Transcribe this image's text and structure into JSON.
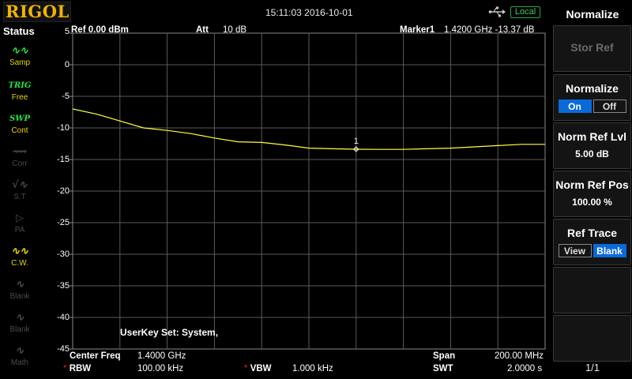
{
  "brand": "RIGOL",
  "datetime": "15:11:03 2016-10-01",
  "local_label": "Local",
  "status": {
    "title": "Status",
    "items": [
      {
        "icon": "samp-wave-icon",
        "glyph": "∿∿",
        "label": "Samp"
      },
      {
        "icon": "trig-icon",
        "glyph": "TRIG",
        "label": "Free"
      },
      {
        "icon": "swp-icon",
        "glyph": "SWP",
        "label": "Cont"
      },
      {
        "icon": "corr-icon",
        "glyph": "⟿",
        "label": "Corr"
      },
      {
        "icon": "st-icon",
        "glyph": "√∿",
        "label": "S.T"
      },
      {
        "icon": "pa-icon",
        "glyph": "▷",
        "label": "PA"
      },
      {
        "icon": "cw-icon",
        "glyph": "∿∿",
        "label": "C.W."
      },
      {
        "icon": "blank-icon",
        "glyph": "∿",
        "label": "Blank"
      },
      {
        "icon": "blank-icon",
        "glyph": "∿",
        "label": "Blank"
      },
      {
        "icon": "math-icon",
        "glyph": "∿",
        "label": "Math"
      }
    ]
  },
  "plot": {
    "ref": "Ref  0.00 dBm",
    "att_label": "Att",
    "att_value": "10 dB",
    "marker_label": "Marker1",
    "marker_value": "1.4200 GHz  -13.37 dB",
    "marker_number": "1",
    "y_labels": [
      "5",
      "0",
      "-5",
      "-10",
      "-15",
      "-20",
      "-25",
      "-30",
      "-35",
      "-40",
      "-45"
    ],
    "userkey": "UserKey Set:    System,",
    "center_freq_label": "Center Freq",
    "center_freq_value": "1.4000 GHz",
    "span_label": "Span",
    "span_value": "200.00 MHz",
    "rbw_label": "RBW",
    "rbw_value": "100.00 kHz",
    "vbw_label": "VBW",
    "vbw_value": "1.000 kHz",
    "swt_label": "SWT",
    "swt_value": "2.0000 s",
    "trace_color": "#ffff40",
    "grid_color": "#5a5a5a"
  },
  "chart_data": {
    "type": "line",
    "x": [
      1.3,
      1.31,
      1.32,
      1.33,
      1.34,
      1.35,
      1.36,
      1.37,
      1.38,
      1.39,
      1.4,
      1.41,
      1.42,
      1.43,
      1.44,
      1.45,
      1.46,
      1.47,
      1.48,
      1.49,
      1.5
    ],
    "y": [
      -7.0,
      -7.8,
      -8.9,
      -10.0,
      -10.4,
      -10.9,
      -11.6,
      -12.2,
      -12.3,
      -12.7,
      -13.2,
      -13.3,
      -13.37,
      -13.4,
      -13.4,
      -13.3,
      -13.2,
      -13.0,
      -12.8,
      -12.6,
      -12.6
    ],
    "ylim": [
      -45,
      5
    ],
    "xlim": [
      1.3,
      1.5
    ],
    "marker_x": 1.42,
    "grid": true
  },
  "menu": {
    "title": "Normalize",
    "stor_ref": "Stor Ref",
    "normalize_title": "Normalize",
    "normalize_on": "On",
    "normalize_off": "Off",
    "norm_ref_lvl_title": "Norm Ref Lvl",
    "norm_ref_lvl_value": "5.00 dB",
    "norm_ref_pos_title": "Norm Ref Pos",
    "norm_ref_pos_value": "100.00 %",
    "ref_trace_title": "Ref Trace",
    "ref_trace_view": "View",
    "ref_trace_blank": "Blank",
    "page_indicator": "1/1"
  }
}
